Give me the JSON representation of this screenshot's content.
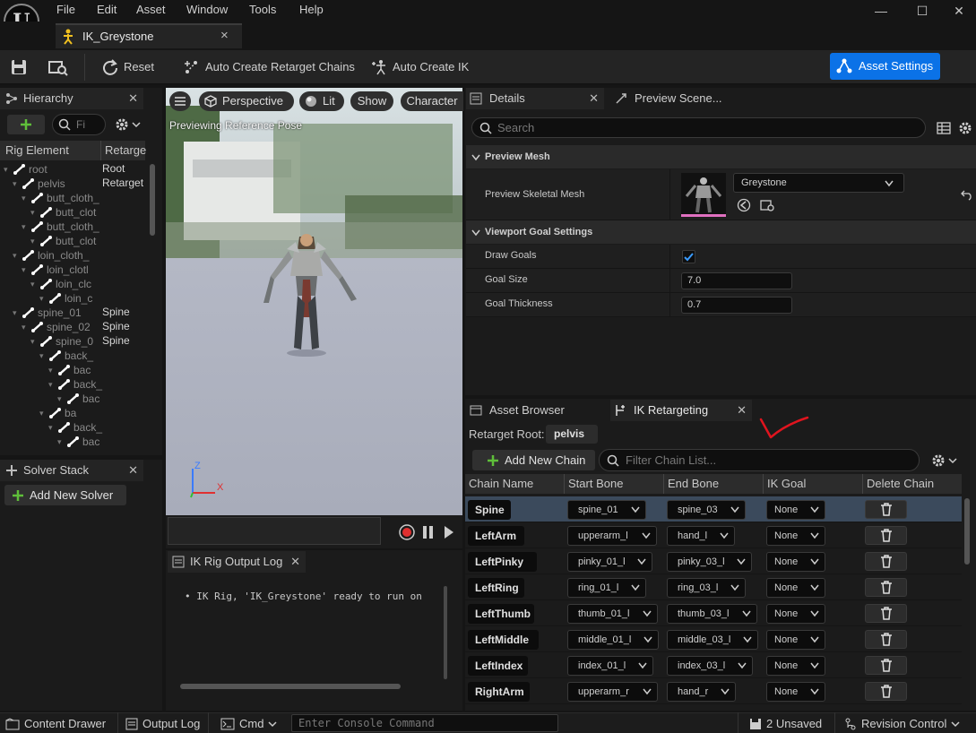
{
  "menu": {
    "items": [
      "File",
      "Edit",
      "Asset",
      "Window",
      "Tools",
      "Help"
    ]
  },
  "window_controls": {
    "minimize": "—",
    "maximize": "☐",
    "close": "✕"
  },
  "document_tab": {
    "title": "IK_Greystone",
    "close": "×"
  },
  "toolbar": {
    "reset": "Reset",
    "auto_create_chains": "Auto Create Retarget Chains",
    "auto_create_ik": "Auto Create IK",
    "asset_settings": "Asset Settings"
  },
  "hierarchy": {
    "tab": "Hierarchy",
    "search_placeholder": "Fi",
    "col_rig_element": "Rig Element",
    "col_retarget": "Retarge",
    "rows": [
      {
        "label": "root",
        "retarget": "Root"
      },
      {
        "label": "pelvis",
        "retarget": "Retarget"
      },
      {
        "label": "butt_cloth_",
        "retarget": ""
      },
      {
        "label": "butt_clot",
        "retarget": ""
      },
      {
        "label": "butt_cloth_",
        "retarget": ""
      },
      {
        "label": "butt_clot",
        "retarget": ""
      },
      {
        "label": "loin_cloth_",
        "retarget": ""
      },
      {
        "label": "loin_clotl",
        "retarget": ""
      },
      {
        "label": "loin_clc",
        "retarget": ""
      },
      {
        "label": "loin_c",
        "retarget": ""
      },
      {
        "label": "spine_01",
        "retarget": "Spine"
      },
      {
        "label": "spine_02",
        "retarget": "Spine"
      },
      {
        "label": "spine_0",
        "retarget": "Spine"
      },
      {
        "label": "back_",
        "retarget": ""
      },
      {
        "label": "bac",
        "retarget": ""
      },
      {
        "label": "back_",
        "retarget": ""
      },
      {
        "label": "bac",
        "retarget": ""
      },
      {
        "label": "ba",
        "retarget": ""
      },
      {
        "label": "back_",
        "retarget": ""
      },
      {
        "label": "bac",
        "retarget": ""
      }
    ]
  },
  "solver_stack": {
    "tab": "Solver Stack",
    "add_button": "Add New Solver"
  },
  "viewport": {
    "perspective": "Perspective",
    "lit": "Lit",
    "show": "Show",
    "character": "Character",
    "caption": "Previewing Reference Pose",
    "axis_z": "Z",
    "axis_x": "X"
  },
  "output_log": {
    "tab": "IK Rig Output Log",
    "message": "IK Rig, 'IK_Greystone' ready to run on"
  },
  "details": {
    "tab": "Details",
    "tab2": "Preview Scene...",
    "search_placeholder": "Search",
    "section_preview": "Preview Mesh",
    "preview_mesh_label": "Preview Skeletal Mesh",
    "preview_mesh_value": "Greystone",
    "section_goal": "Viewport Goal Settings",
    "draw_goals_label": "Draw Goals",
    "goal_size_label": "Goal Size",
    "goal_size_value": "7.0",
    "goal_thickness_label": "Goal Thickness",
    "goal_thickness_value": "0.7"
  },
  "retargeting": {
    "tab_asset_browser": "Asset Browser",
    "tab_ik_retargeting": "IK Retargeting",
    "retarget_root_label": "Retarget Root:",
    "retarget_root_value": "pelvis",
    "add_chain": "Add New Chain",
    "filter_placeholder": "Filter Chain List...",
    "columns": [
      "Chain Name",
      "Start Bone",
      "End Bone",
      "IK Goal",
      "Delete Chain"
    ],
    "rows": [
      {
        "name": "Spine",
        "start": "spine_01",
        "end": "spine_03",
        "goal": "None"
      },
      {
        "name": "LeftArm",
        "start": "upperarm_l",
        "end": "hand_l",
        "goal": "None"
      },
      {
        "name": "LeftPinky",
        "start": "pinky_01_l",
        "end": "pinky_03_l",
        "goal": "None"
      },
      {
        "name": "LeftRing",
        "start": "ring_01_l",
        "end": "ring_03_l",
        "goal": "None"
      },
      {
        "name": "LeftThumb",
        "start": "thumb_01_l",
        "end": "thumb_03_l",
        "goal": "None"
      },
      {
        "name": "LeftMiddle",
        "start": "middle_01_l",
        "end": "middle_03_l",
        "goal": "None"
      },
      {
        "name": "LeftIndex",
        "start": "index_01_l",
        "end": "index_03_l",
        "goal": "None"
      },
      {
        "name": "RightArm",
        "start": "upperarm_r",
        "end": "hand_r",
        "goal": "None"
      }
    ]
  },
  "statusbar": {
    "content_drawer": "Content Drawer",
    "output_log": "Output Log",
    "cmd": "Cmd",
    "console_placeholder": "Enter Console Command",
    "unsaved": "2 Unsaved",
    "revision_control": "Revision Control"
  },
  "colors": {
    "accent": "#0b72e7",
    "green": "#5fbf3a",
    "annotation_red": "#e0141e",
    "selected_row": "#3b4a5c"
  }
}
